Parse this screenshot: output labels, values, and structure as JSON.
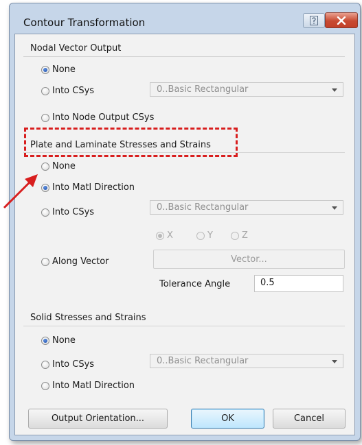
{
  "dialog": {
    "title": "Contour Transformation",
    "help_glyph": "?",
    "close_glyph": "✕"
  },
  "nodal": {
    "heading": "Nodal Vector Output",
    "opt_none": "None",
    "opt_into_csys": "Into CSys",
    "opt_into_node": "Into Node Output CSys",
    "csys_value": "0..Basic Rectangular",
    "selected": "None"
  },
  "plate": {
    "heading": "Plate and Laminate Stresses and Strains",
    "opt_none": "None",
    "opt_matl": "Into Matl Direction",
    "opt_csys": "Into CSys",
    "csys_value": "0..Basic Rectangular",
    "axis_x": "X",
    "axis_y": "Y",
    "axis_z": "Z",
    "opt_vector": "Along Vector",
    "vector_button": "Vector...",
    "tolerance_label": "Tolerance Angle",
    "tolerance_value": "0.5",
    "selected": "Into Matl Direction"
  },
  "solid": {
    "heading": "Solid Stresses and Strains",
    "opt_none": "None",
    "opt_csys": "Into CSys",
    "opt_matl": "Into Matl Direction",
    "csys_value": "0..Basic Rectangular",
    "selected": "None"
  },
  "buttons": {
    "orientation": "Output Orientation...",
    "ok": "OK",
    "cancel": "Cancel"
  },
  "annotation": {
    "highlight_color": "#d81e1e"
  }
}
